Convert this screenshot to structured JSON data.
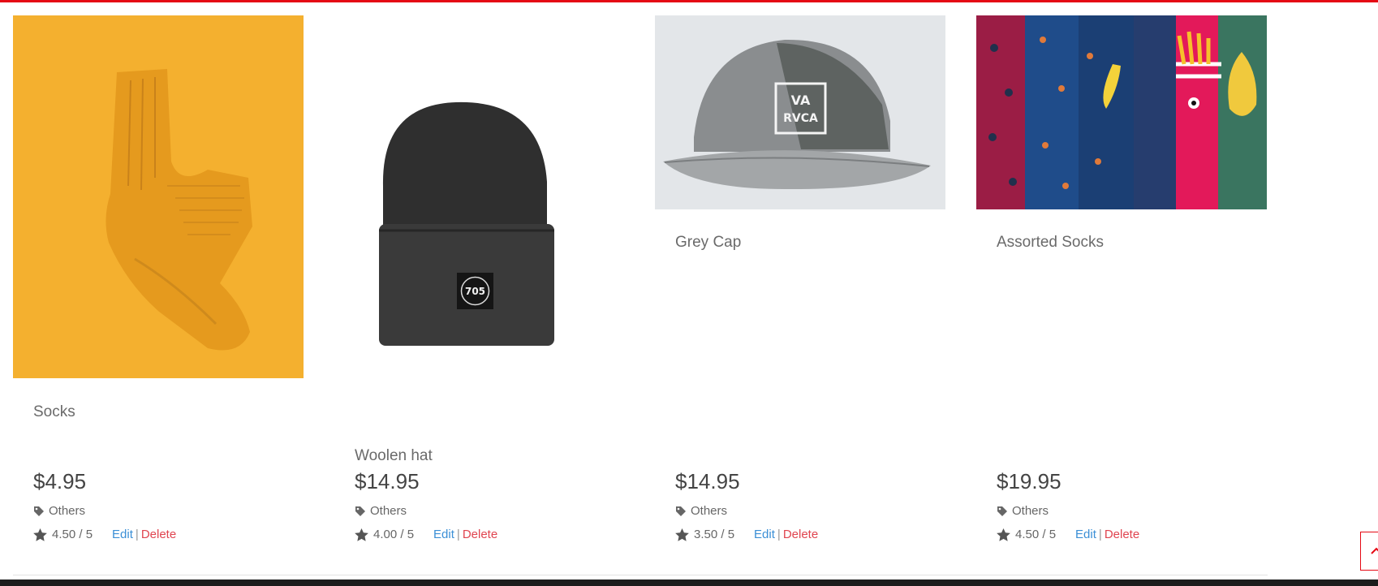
{
  "colors": {
    "accent": "#e50914",
    "link_edit": "#3b8fd6",
    "link_delete": "#e0444f"
  },
  "products": [
    {
      "title": "Socks",
      "price": "$4.95",
      "category": "Others",
      "rating": "4.50 / 5",
      "edit_label": "Edit",
      "delete_label": "Delete",
      "image": "mustard-sock-photo"
    },
    {
      "title": "Woolen hat",
      "price": "$14.95",
      "category": "Others",
      "rating": "4.00 / 5",
      "edit_label": "Edit",
      "delete_label": "Delete",
      "image": "black-beanie-photo"
    },
    {
      "title": "Grey Cap",
      "price": "$14.95",
      "category": "Others",
      "rating": "3.50 / 5",
      "edit_label": "Edit",
      "delete_label": "Delete",
      "image": "grey-cap-photo"
    },
    {
      "title": "Assorted Socks",
      "price": "$19.95",
      "category": "Others",
      "rating": "4.50 / 5",
      "edit_label": "Edit",
      "delete_label": "Delete",
      "image": "assorted-socks-photo"
    }
  ],
  "images": {
    "beanie_patch_text": "705",
    "cap_logo_top": "VA",
    "cap_logo_bottom": "RVCA"
  },
  "icons": {
    "category": "tag-icon",
    "rating": "star-icon",
    "scroll": "chevron-up-icon"
  }
}
